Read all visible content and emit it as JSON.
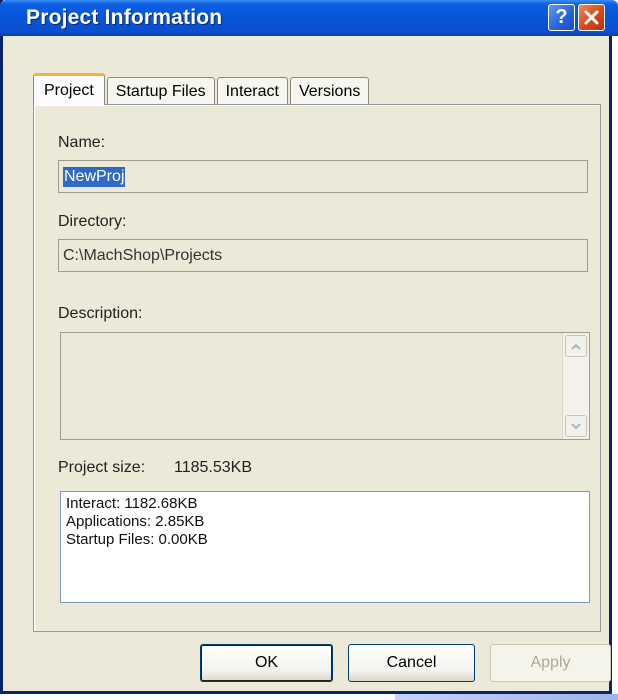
{
  "window": {
    "title": "Project Information",
    "help_glyph": "?",
    "close_icon": "close-x-icon"
  },
  "tabs": [
    {
      "label": "Project",
      "active": true
    },
    {
      "label": "Startup Files",
      "active": false
    },
    {
      "label": "Interact",
      "active": false
    },
    {
      "label": "Versions",
      "active": false
    }
  ],
  "project": {
    "name_label": "Name:",
    "name_value": "NewProj",
    "directory_label": "Directory:",
    "directory_value": "C:\\MachShop\\Projects",
    "description_label": "Description:",
    "description_value": "",
    "size_label": "Project size:",
    "size_value": "1185.53KB",
    "size_breakdown": [
      "Interact: 1182.68KB",
      "Applications: 2.85KB",
      "Startup Files: 0.00KB"
    ]
  },
  "buttons": {
    "ok": "OK",
    "cancel": "Cancel",
    "apply": "Apply"
  },
  "colors": {
    "title_bar": "#0753d6",
    "selection": "#316ac5",
    "active_tab_accent": "#f4b43a"
  }
}
